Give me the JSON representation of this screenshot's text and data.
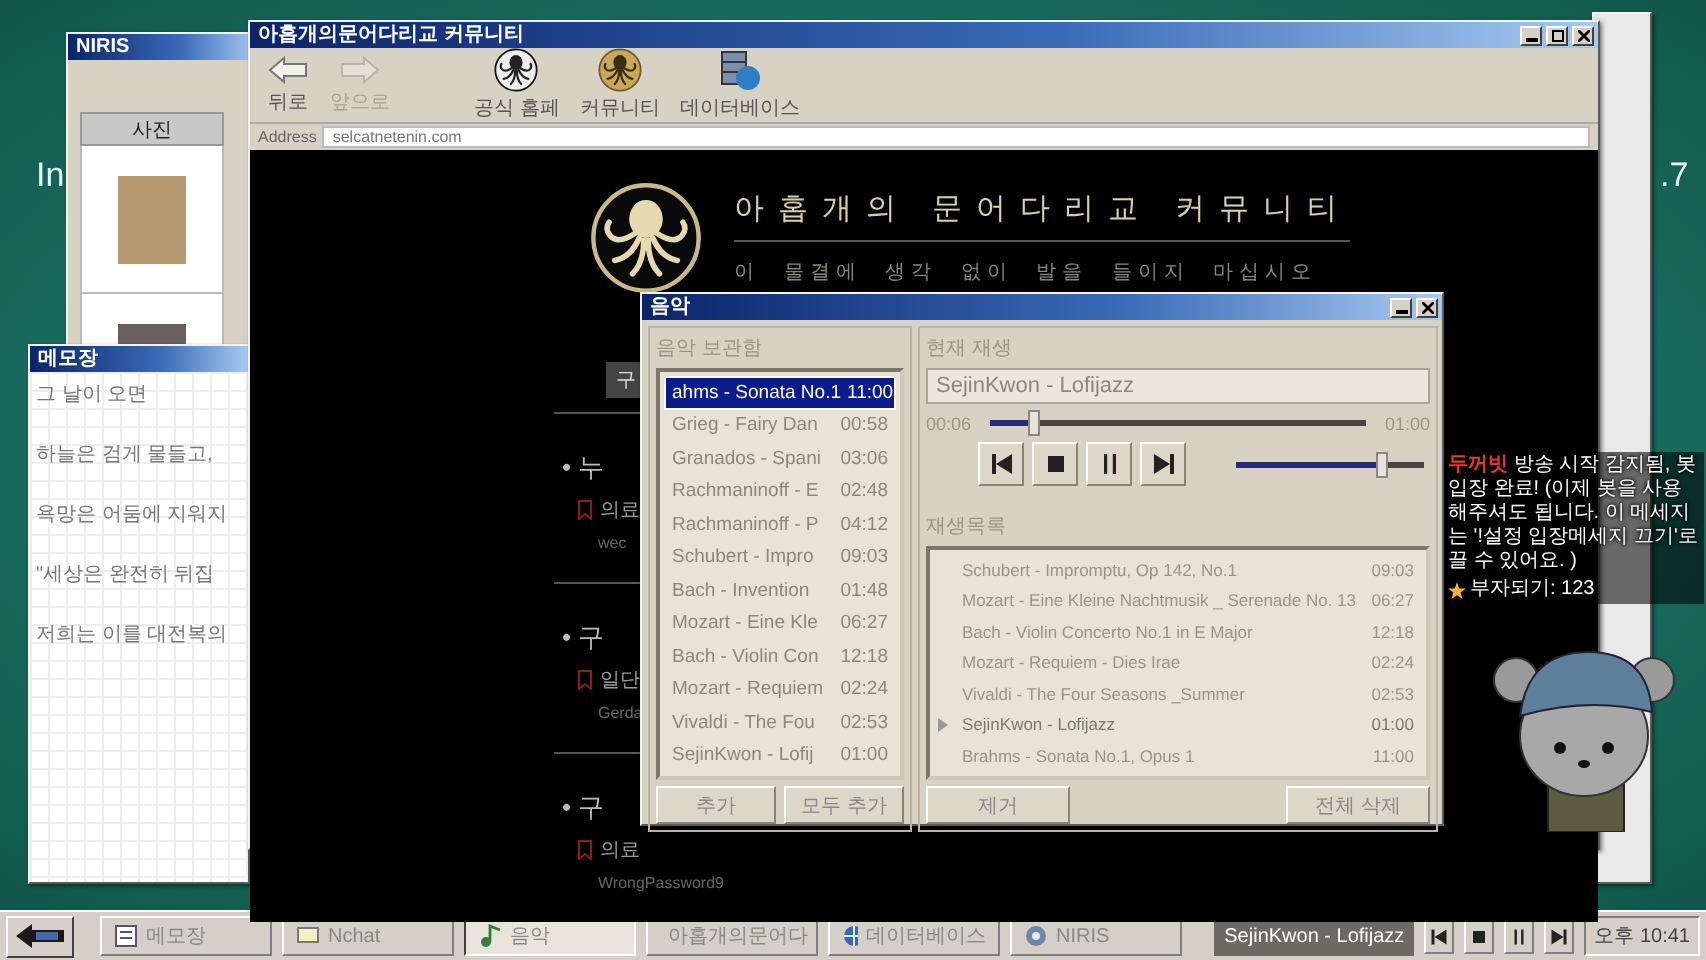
{
  "desktop_labels": [
    "In",
    ".7"
  ],
  "niris": {
    "title": "NIRIS",
    "column": "사진"
  },
  "memo": {
    "title": "메모장",
    "lines": [
      "그 날이 오면",
      "하늘은 검게 물들고,",
      "욕망은 어둠에 지워지",
      "\"세상은 완전히 뒤집",
      "저희는 이를 대전복의"
    ]
  },
  "browser": {
    "title": "아홉개의문어다리교 커뮤니티",
    "nav": [
      {
        "label": "뒤로",
        "disabled": false
      },
      {
        "label": "앞으로",
        "disabled": true
      }
    ],
    "links": [
      "공식 홈페",
      "커뮤니티",
      "데이터베이스"
    ],
    "address_label": "Address",
    "address": "selcatnetenin.com",
    "site_title": "아홉개의 문어다리교 커뮤니티",
    "site_subtitle": "이 물결에 생각 없이 발을 들이지 마십시오",
    "search_button": "구",
    "posts": [
      {
        "title": "• 누",
        "snippet": "의료",
        "meta": "wec"
      },
      {
        "title": "• 구",
        "snippet": "일단",
        "meta": "Gerda"
      },
      {
        "title": "• 구",
        "snippet": "의료",
        "meta": "WrongPassword9"
      }
    ]
  },
  "music": {
    "title": "음악",
    "library_label": "음악 보관함",
    "library": [
      {
        "title": "ahms - Sonata No.1",
        "time": "11:00",
        "selected": true
      },
      {
        "title": "Grieg - Fairy Dan",
        "time": "00:58",
        "selected": false
      },
      {
        "title": "Granados - Spani",
        "time": "03:06",
        "selected": false
      },
      {
        "title": "Rachmaninoff - E",
        "time": "02:48",
        "selected": false
      },
      {
        "title": "Rachmaninoff - P",
        "time": "04:12",
        "selected": false
      },
      {
        "title": "Schubert - Impro",
        "time": "09:03",
        "selected": false
      },
      {
        "title": "Bach - Invention",
        "time": "01:48",
        "selected": false
      },
      {
        "title": "Mozart - Eine Kle",
        "time": "06:27",
        "selected": false
      },
      {
        "title": "Bach - Violin Con",
        "time": "12:18",
        "selected": false
      },
      {
        "title": "Mozart - Requiem",
        "time": "02:24",
        "selected": false
      },
      {
        "title": "Vivaldi - The Fou",
        "time": "02:53",
        "selected": false
      },
      {
        "title": "SejinKwon - Lofij",
        "time": "01:00",
        "selected": false
      }
    ],
    "library_buttons": [
      "추가",
      "모두 추가"
    ],
    "now_label": "현재 재생",
    "now_playing": "SejinKwon - Lofijazz",
    "elapsed": "00:06",
    "total": "01:00",
    "progress": {
      "level": 0.12
    },
    "volume": {
      "level": 0.78
    },
    "playlist_label": "재생목록",
    "playlist": [
      {
        "title": "Schubert - Impromptu, Op 142, No.1",
        "time": "09:03",
        "current": false
      },
      {
        "title": "Mozart - Eine Kleine Nachtmusik _ Serenade No. 13",
        "time": "06:27",
        "current": false
      },
      {
        "title": "Bach - Violin Concerto No.1 in E Major",
        "time": "12:18",
        "current": false
      },
      {
        "title": "Mozart - Requiem - Dies Irae",
        "time": "02:24",
        "current": false
      },
      {
        "title": "Vivaldi - The Four Seasons _Summer",
        "time": "02:53",
        "current": false
      },
      {
        "title": "SejinKwon - Lofijazz",
        "time": "01:00",
        "current": true
      },
      {
        "title": "Brahms - Sonata No.1, Opus 1",
        "time": "11:00",
        "current": false
      }
    ],
    "playlist_buttons": [
      "제거",
      "전체 삭제"
    ]
  },
  "chat": {
    "name": "두꺼빗",
    "message": "방송 시작 감지됨, 봇 입장 완료! (이제 봇을 사용해주셔도 됩니다. 이 메세지는 '!설정 입장메세지 끄기'로 끌 수 있어요. )",
    "points": "부자되기: 123"
  },
  "taskbar": {
    "tasks": [
      {
        "label": "메모장",
        "selected": false
      },
      {
        "label": "Nchat",
        "selected": false
      },
      {
        "label": "음악",
        "selected": true
      },
      {
        "label": "아홉개의문어다",
        "selected": false
      },
      {
        "label": "데이터베이스",
        "selected": false
      },
      {
        "label": "NIRIS",
        "selected": false
      }
    ],
    "now_playing": "SejinKwon - Lofijazz",
    "clock": "오후 10:41"
  }
}
